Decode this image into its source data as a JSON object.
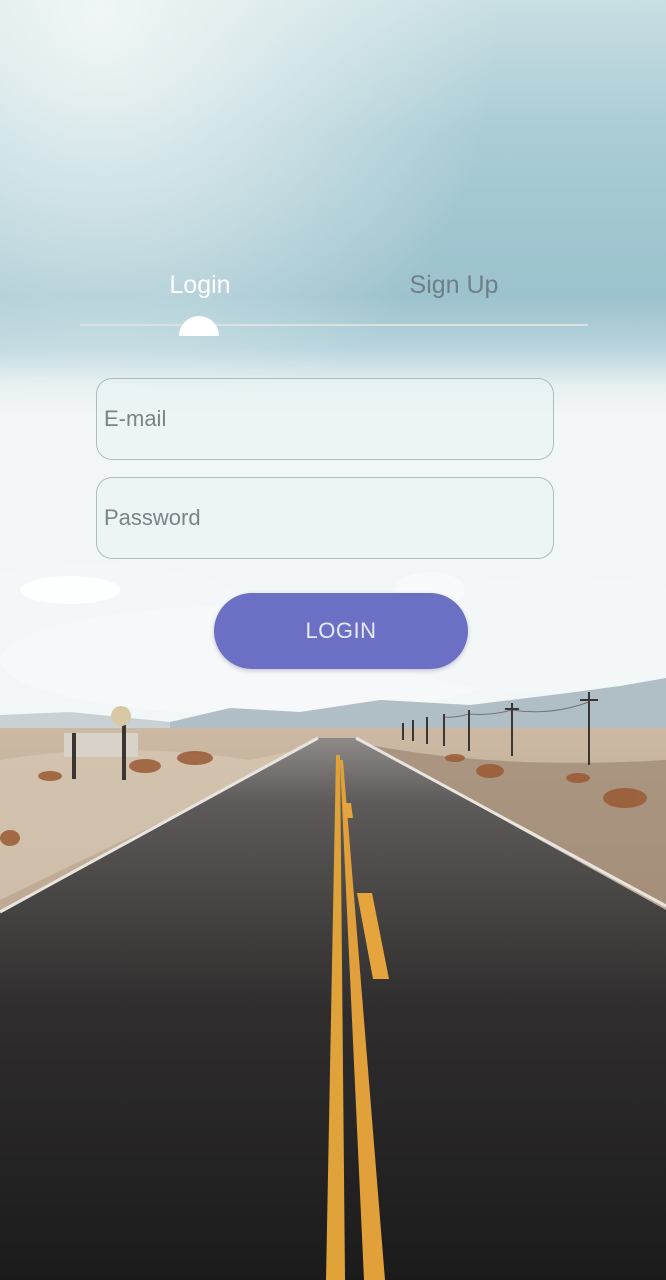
{
  "tabs": {
    "login_label": "Login",
    "signup_label": "Sign Up",
    "active": "Login"
  },
  "form": {
    "email_placeholder": "E-mail",
    "email_value": "",
    "password_placeholder": "Password",
    "password_value": ""
  },
  "actions": {
    "login_label": "LOGIN"
  },
  "colors": {
    "accent": "#6b70c4",
    "active_tab": "#ffffff",
    "inactive_tab": "#6f7f88"
  },
  "background": {
    "scene": "road-desert-sky-image"
  }
}
